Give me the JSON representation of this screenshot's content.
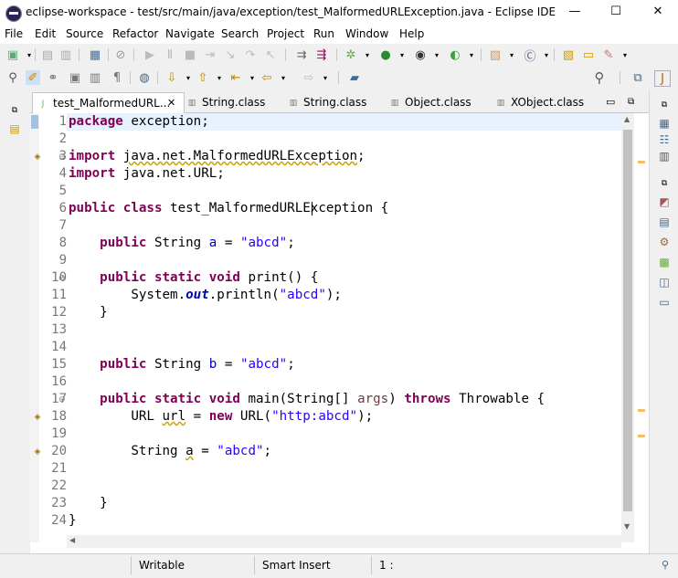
{
  "window": {
    "title": "eclipse-workspace - test/src/main/java/exception/test_MalformedURLException.java - Eclipse IDE",
    "minimize": "—",
    "maximize": "☐",
    "close": "✕"
  },
  "menu": [
    "File",
    "Edit",
    "Source",
    "Refactor",
    "Navigate",
    "Search",
    "Project",
    "Run",
    "Window",
    "Help"
  ],
  "tabs": [
    {
      "label": "test_MalformedURL...",
      "active": true,
      "icon": "java-file-icon",
      "close": "✕"
    },
    {
      "label": "String.class",
      "active": false,
      "icon": "class-file-icon"
    },
    {
      "label": "String.class",
      "active": false,
      "icon": "class-file-icon"
    },
    {
      "label": "Object.class",
      "active": false,
      "icon": "class-file-icon"
    },
    {
      "label": "XObject.class",
      "active": false,
      "icon": "class-file-icon"
    }
  ],
  "line_numbers": [
    "1",
    "2",
    "3",
    "4",
    "5",
    "6",
    "7",
    "8",
    "9",
    "10",
    "11",
    "12",
    "13",
    "14",
    "15",
    "16",
    "17",
    "18",
    "19",
    "20",
    "21",
    "22",
    "23",
    "24"
  ],
  "status": {
    "writable": "Writable",
    "insert_mode": "Smart Insert",
    "position": "1 :"
  },
  "colors": {
    "keyword": "#7f0055",
    "string": "#2a00ff",
    "field": "#0000c0",
    "current_line": "#e8f2fe"
  }
}
